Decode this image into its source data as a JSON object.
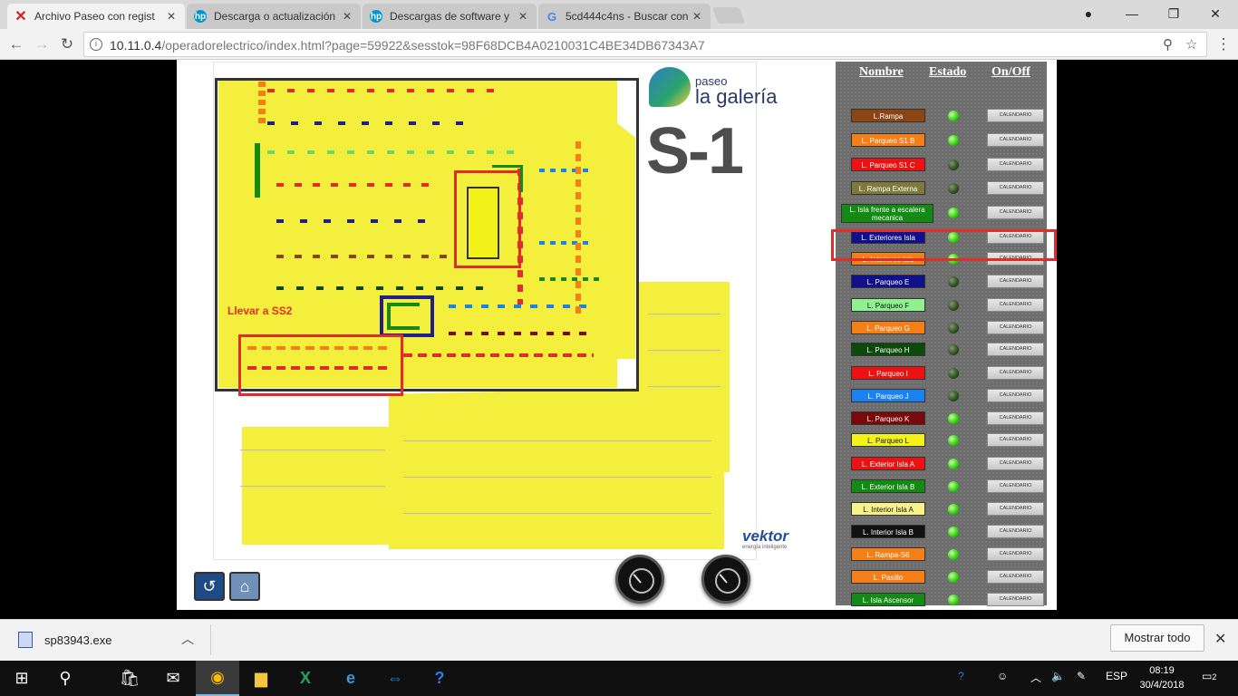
{
  "browser": {
    "tabs": [
      {
        "title": "Archivo Paseo con regist",
        "favicon": "red-x",
        "active": true
      },
      {
        "title": "Descarga o actualización",
        "favicon": "hp"
      },
      {
        "title": "Descargas de software y",
        "favicon": "hp"
      },
      {
        "title": "5cd444c4ns - Buscar con",
        "favicon": "google"
      }
    ],
    "url_host": "10.11.0.4",
    "url_rest": "/operadorelectrico/index.html?page=59922&sesstok=98F68DCB4A0210031C4BE34DB67343A7"
  },
  "plan": {
    "ss2_label": "Llevar a SS2",
    "logo_line1": "paseo",
    "logo_line2": "la galería",
    "level": "S-1",
    "brand": "vektor",
    "brand_sub": "energía inteligente"
  },
  "panel": {
    "headers": {
      "name": "Nombre",
      "state": "Estado",
      "onoff": "On/Off"
    },
    "button_label": "CALENDARIO",
    "rows": [
      {
        "name": "L.Rampa",
        "color": "#8b4513",
        "on": true
      },
      {
        "name": "L. Parqueo S1 B",
        "color": "#f57f17",
        "on": true
      },
      {
        "name": "L. Parqueo S1 C",
        "color": "#ee1111",
        "on": false
      },
      {
        "name": "L. Rampa Externa",
        "color": "#7d7a3a",
        "on": false
      },
      {
        "name": "L. Isla frente a escalera mecanica",
        "color": "#138a13",
        "on": true
      },
      {
        "name": "L. Exteriores Isla",
        "color": "#10108c",
        "on": true
      },
      {
        "name": "L. Interiores Isla",
        "color": "#f57f17",
        "on": true
      },
      {
        "name": "L. Parqueo E",
        "color": "#10108c",
        "on": false
      },
      {
        "name": "L. Parqueo F",
        "color": "#8ff08f",
        "on": false
      },
      {
        "name": "L. Parqueo G",
        "color": "#f57f17",
        "on": false
      },
      {
        "name": "L. Parqueo H",
        "color": "#0b4a0b",
        "on": false
      },
      {
        "name": "L. Parqueo I",
        "color": "#ee1111",
        "on": false
      },
      {
        "name": "L. Parqueo J",
        "color": "#1a82f0",
        "on": false
      },
      {
        "name": "L. Parqueo K",
        "color": "#7a0a0a",
        "on": true
      },
      {
        "name": "L. Parqueo L",
        "color": "#f3f31a",
        "on": true
      },
      {
        "name": "L. Exterior Isla A",
        "color": "#ee1111",
        "on": true
      },
      {
        "name": "L. Exterior Isla B",
        "color": "#138a13",
        "on": true
      },
      {
        "name": "L. Interior Isla A",
        "color": "#f7f28a",
        "on": true
      },
      {
        "name": "L. Interior Isla B",
        "color": "#111111",
        "on": true
      },
      {
        "name": "L. Rampa-S6",
        "color": "#f57f17",
        "on": true
      },
      {
        "name": "L. Pasillo",
        "color": "#f57f17",
        "on": true
      },
      {
        "name": "L. Isla Ascensor",
        "color": "#138a13",
        "on": true
      }
    ]
  },
  "downloads": {
    "file": "sp83943.exe",
    "show_all": "Mostrar todo"
  },
  "taskbar": {
    "lang": "ESP",
    "time": "08:19",
    "date": "30/4/2018",
    "notifications": "2"
  }
}
